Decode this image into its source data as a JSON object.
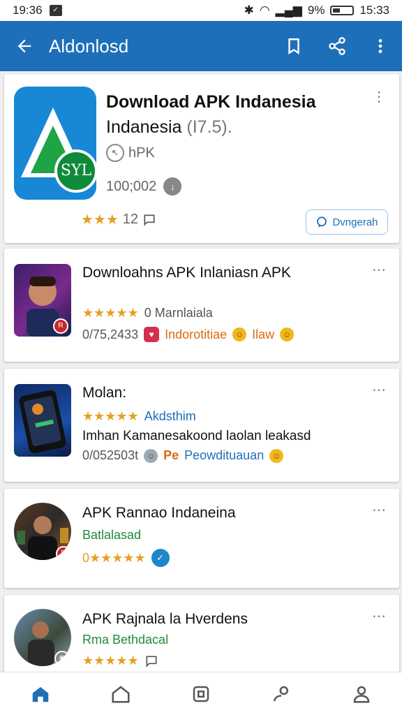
{
  "status_bar": {
    "time_left": "19:36",
    "battery": "9%",
    "time_right": "15:33"
  },
  "app_bar": {
    "title": "Aldonlosd"
  },
  "featured": {
    "title_line1": "Download APK Indanesia",
    "title_line2": "Indanesia",
    "version": "(I7.5).",
    "type": "hPK",
    "downloads": "100;002",
    "rating_count": "12",
    "install_button": "Dvngerah",
    "icon_text": "SYL"
  },
  "items": [
    {
      "title": "Downloahns APK Inlaniasn APK",
      "stars": "★★★★★",
      "subtitle": "0 Marnlaiala",
      "meta": "0/75,2433",
      "tag": "Indorotitiae",
      "tag2": "Ilaw"
    },
    {
      "title": "Molan:",
      "stars": "★★★★★",
      "subtitle": "Akdsthim",
      "desc": "Imhan Kamanesakoond laolan leakasd",
      "meta": "0/052503t",
      "tag": "Pe",
      "tag2": "Peowdituauan"
    },
    {
      "title": "APK Rannao Indaneina",
      "subtitle": "Batlalasad",
      "stars": "0★★★★★"
    },
    {
      "title": "APK Rajnala la Hverdens",
      "subtitle": "Rma Bethdacal",
      "stars": "★★★★★"
    }
  ],
  "colors": {
    "primary": "#1d6fb9",
    "star": "#e5a021"
  }
}
